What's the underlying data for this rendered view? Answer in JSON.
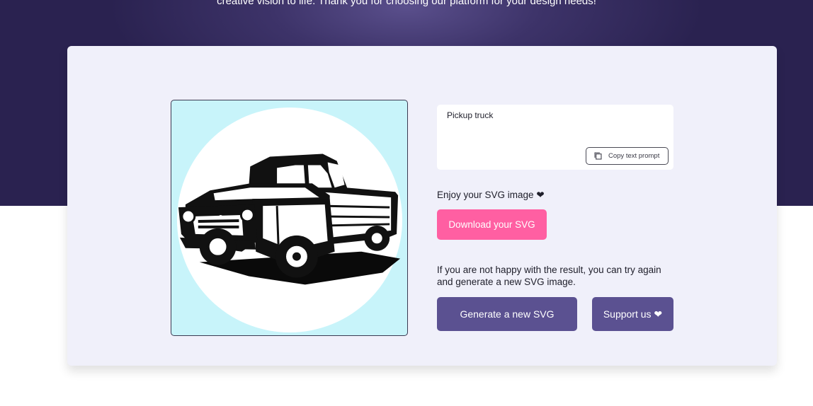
{
  "hero": {
    "subtitle": "creative vision to life. Thank you for choosing our platform for your design needs!"
  },
  "prompt": {
    "text": "Pickup truck",
    "copy_label": "Copy text prompt"
  },
  "result": {
    "enjoy_text": "Enjoy your SVG image ❤",
    "download_label": "Download your SVG",
    "retry_text": "If you are not happy with the result, you can try again and generate a new SVG image.",
    "generate_label": "Generate a new SVG",
    "support_label": "Support us ❤"
  },
  "colors": {
    "hero_bg": "#3d3369",
    "accent_pink": "#ff5fa2",
    "button_purple": "#5b5191",
    "card_bg": "#f0f0fa",
    "image_bg": "#c8f4fa"
  },
  "icons": {
    "copy": "copy-icon"
  }
}
